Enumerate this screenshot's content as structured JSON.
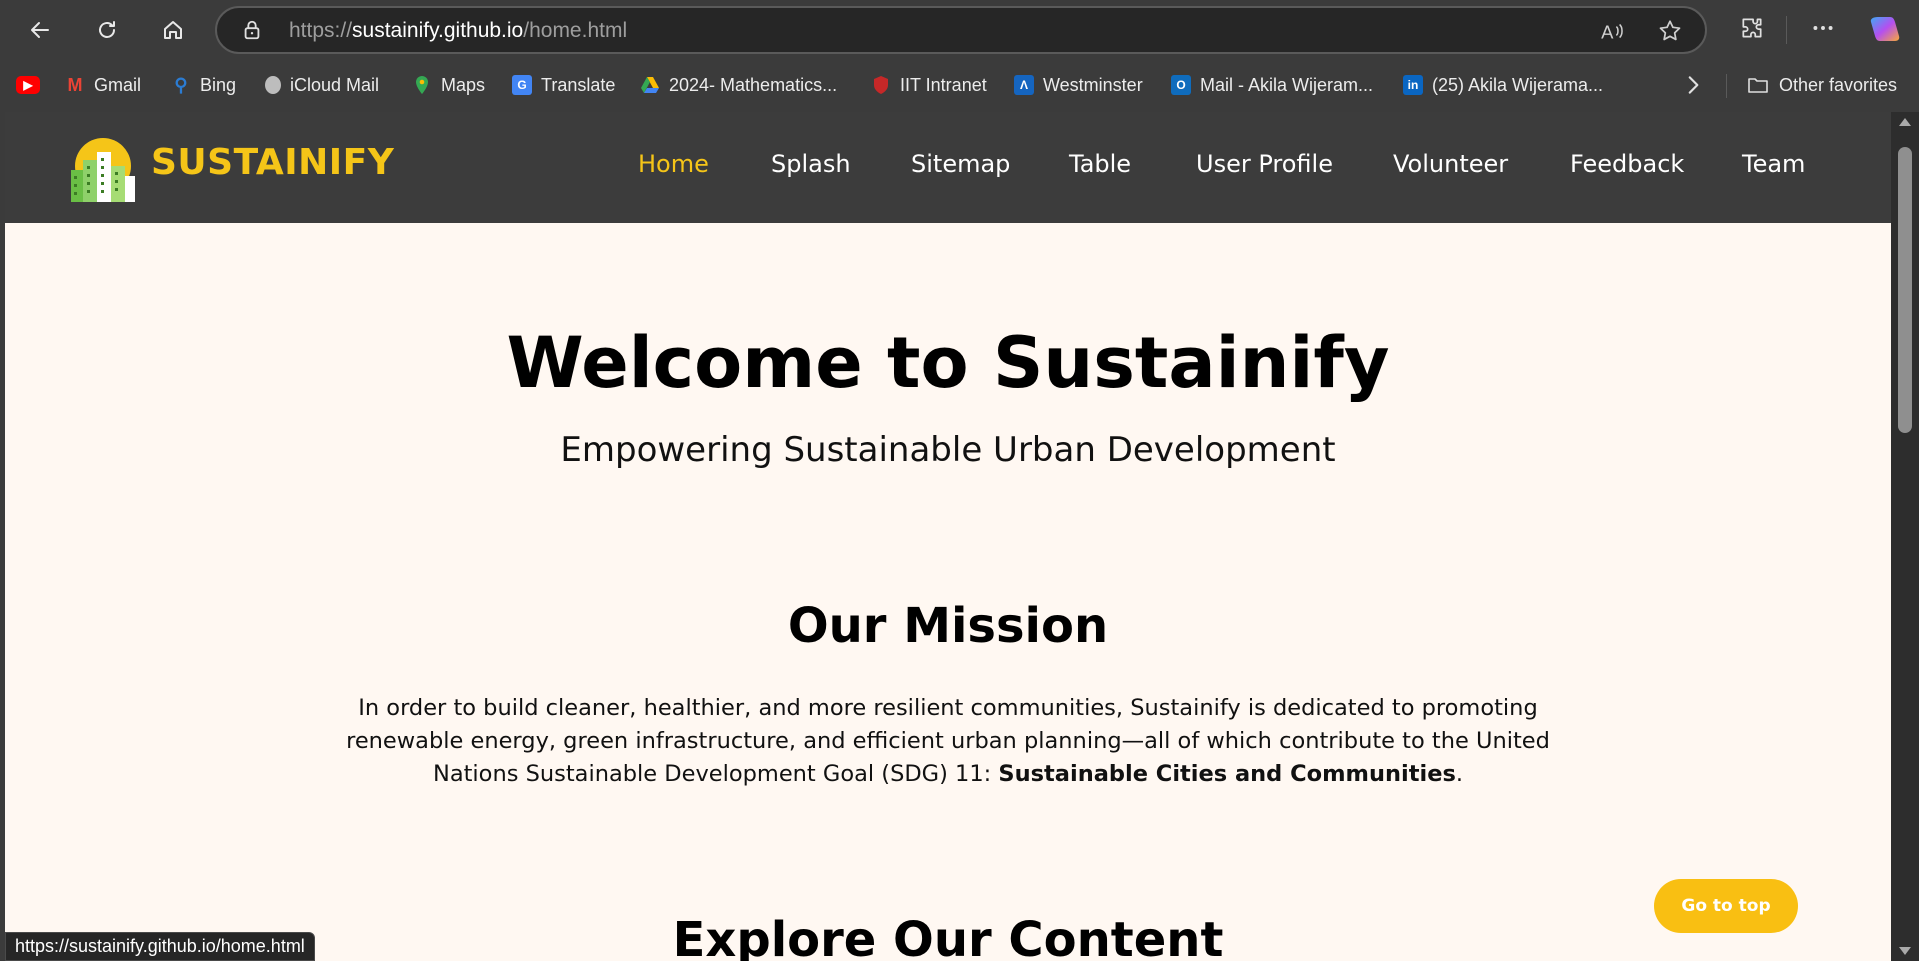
{
  "browser": {
    "url_scheme": "https://",
    "url_host": "sustainify.github.io",
    "url_path": "/home.html",
    "status_url": "https://sustainify.github.io/home.html",
    "bookmarks": [
      {
        "label": "",
        "icon": "youtube-icon",
        "color": "#ff0000"
      },
      {
        "label": "Gmail",
        "icon": "gmail-icon",
        "color": "#ea4335"
      },
      {
        "label": "Bing",
        "icon": "bing-search-icon",
        "color": "#2b7cd3"
      },
      {
        "label": "iCloud Mail",
        "icon": "apple-icon",
        "color": "#bdbdbd"
      },
      {
        "label": "Maps",
        "icon": "maps-pin-icon",
        "color": "#34a853"
      },
      {
        "label": "Translate",
        "icon": "translate-icon",
        "color": "#4285f4"
      },
      {
        "label": "2024- Mathematics...",
        "icon": "drive-icon",
        "color": "#fbbc04"
      },
      {
        "label": "IIT Intranet",
        "icon": "shield-icon",
        "color": "#c62828"
      },
      {
        "label": "Westminster",
        "icon": "westminster-icon",
        "color": "#1565c0"
      },
      {
        "label": "Mail - Akila Wijeram...",
        "icon": "outlook-icon",
        "color": "#0f6cbd"
      },
      {
        "label": "(25) Akila Wijerama...",
        "icon": "linkedin-icon",
        "color": "#0a66c2"
      }
    ],
    "other_favorites": "Other favorites"
  },
  "site": {
    "brand": "SUSTAINIFY",
    "accent_color": "#f5c518",
    "nav": [
      {
        "label": "Home",
        "active": true
      },
      {
        "label": "Splash",
        "active": false
      },
      {
        "label": "Sitemap",
        "active": false
      },
      {
        "label": "Table",
        "active": false
      },
      {
        "label": "User Profile",
        "active": false
      },
      {
        "label": "Volunteer",
        "active": false
      },
      {
        "label": "Feedback",
        "active": false
      },
      {
        "label": "Team",
        "active": false
      }
    ]
  },
  "hero": {
    "title": "Welcome to Sustainify",
    "subtitle": "Empowering Sustainable Urban Development"
  },
  "mission": {
    "title": "Our Mission",
    "text_before": "In order to build cleaner, healthier, and more resilient communities, Sustainify is dedicated to promoting renewable energy, green infrastructure, and efficient urban planning—all of which contribute to the United Nations Sustainable Development Goal (SDG) 11: ",
    "text_bold": "Sustainable Cities and Communities",
    "text_after": "."
  },
  "explore": {
    "title": "Explore Our Content"
  },
  "go_top_label": "Go to top"
}
